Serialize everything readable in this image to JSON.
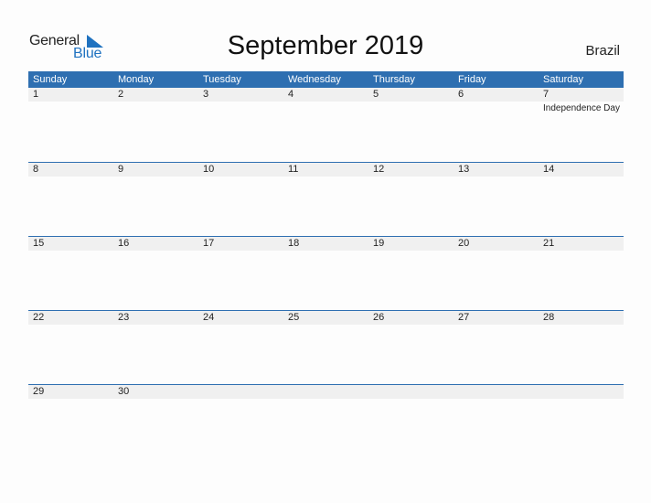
{
  "logo": {
    "line1": "General",
    "line2": "Blue"
  },
  "title": "September 2019",
  "country": "Brazil",
  "colors": {
    "accent": "#2e6fb1",
    "band": "#f0f0f0",
    "logo_blue": "#1f72c0"
  },
  "weekdays": [
    "Sunday",
    "Monday",
    "Tuesday",
    "Wednesday",
    "Thursday",
    "Friday",
    "Saturday"
  ],
  "weeks": [
    [
      {
        "d": "1"
      },
      {
        "d": "2"
      },
      {
        "d": "3"
      },
      {
        "d": "4"
      },
      {
        "d": "5"
      },
      {
        "d": "6"
      },
      {
        "d": "7",
        "holiday": "Independence Day"
      }
    ],
    [
      {
        "d": "8"
      },
      {
        "d": "9"
      },
      {
        "d": "10"
      },
      {
        "d": "11"
      },
      {
        "d": "12"
      },
      {
        "d": "13"
      },
      {
        "d": "14"
      }
    ],
    [
      {
        "d": "15"
      },
      {
        "d": "16"
      },
      {
        "d": "17"
      },
      {
        "d": "18"
      },
      {
        "d": "19"
      },
      {
        "d": "20"
      },
      {
        "d": "21"
      }
    ],
    [
      {
        "d": "22"
      },
      {
        "d": "23"
      },
      {
        "d": "24"
      },
      {
        "d": "25"
      },
      {
        "d": "26"
      },
      {
        "d": "27"
      },
      {
        "d": "28"
      }
    ],
    [
      {
        "d": "29"
      },
      {
        "d": "30"
      },
      {
        "d": ""
      },
      {
        "d": ""
      },
      {
        "d": ""
      },
      {
        "d": ""
      },
      {
        "d": ""
      }
    ]
  ]
}
